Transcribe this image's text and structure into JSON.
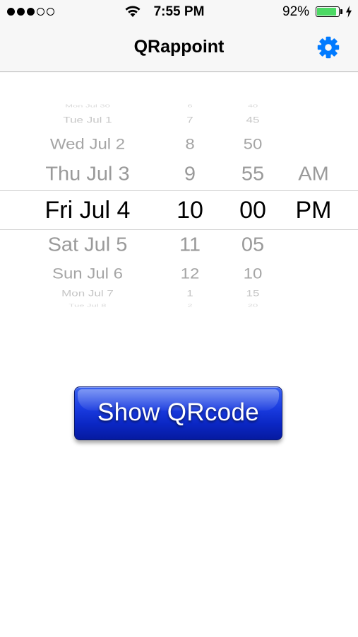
{
  "status_bar": {
    "signal_full": 3,
    "signal_empty": 2,
    "time": "7:55 PM",
    "battery_percent": "92%",
    "battery_level": 0.92,
    "battery_color": "#4cd964"
  },
  "nav": {
    "title": "QRappoint",
    "settings_icon": "gear-icon",
    "accent_color": "#007aff"
  },
  "picker": {
    "rows": [
      {
        "date": "Mon Jul 30",
        "hour": "6",
        "minute": "40",
        "ampm": ""
      },
      {
        "date": "Tue Jul 1",
        "hour": "7",
        "minute": "45",
        "ampm": ""
      },
      {
        "date": "Wed Jul 2",
        "hour": "8",
        "minute": "50",
        "ampm": ""
      },
      {
        "date": "Thu Jul 3",
        "hour": "9",
        "minute": "55",
        "ampm": "AM"
      },
      {
        "date": "Fri Jul 4",
        "hour": "10",
        "minute": "00",
        "ampm": "PM"
      },
      {
        "date": "Sat Jul 5",
        "hour": "11",
        "minute": "05",
        "ampm": ""
      },
      {
        "date": "Sun Jul 6",
        "hour": "12",
        "minute": "10",
        "ampm": ""
      },
      {
        "date": "Mon Jul 7",
        "hour": "1",
        "minute": "15",
        "ampm": ""
      },
      {
        "date": "Tue Jul 8",
        "hour": "2",
        "minute": "20",
        "ampm": ""
      }
    ],
    "selected_index": 4
  },
  "action": {
    "show_qrcode_label": "Show QRcode",
    "button_color": "#1a3ce0"
  }
}
